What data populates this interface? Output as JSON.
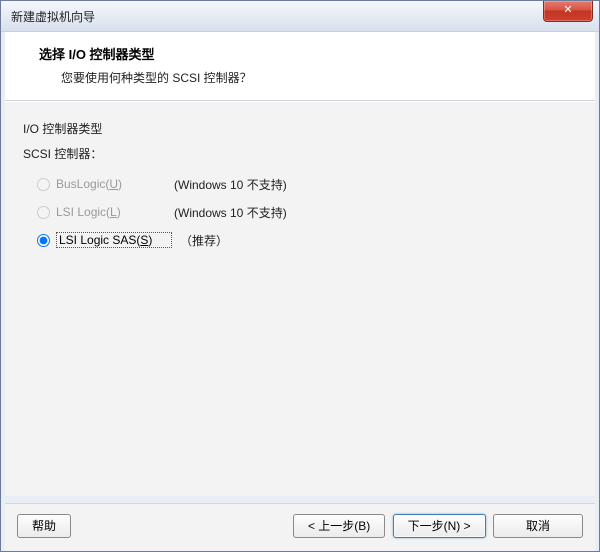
{
  "window": {
    "title": "新建虚拟机向导",
    "close_glyph": "✕"
  },
  "header": {
    "heading": "选择 I/O 控制器类型",
    "subtext": "您要使用何种类型的 SCSI 控制器？"
  },
  "content": {
    "section_label": "I/O 控制器类型",
    "group_label": "SCSI 控制器：",
    "options": [
      {
        "label": "BusLogic(U)",
        "accel": "U",
        "note": "(Windows 10 不支持)",
        "disabled": true,
        "selected": false
      },
      {
        "label": "LSI Logic(L)",
        "accel": "L",
        "note": "(Windows 10 不支持)",
        "disabled": true,
        "selected": false
      },
      {
        "label": "LSI Logic SAS(S)",
        "accel": "S",
        "note": "（推荐）",
        "disabled": false,
        "selected": true
      }
    ]
  },
  "footer": {
    "help": "帮助",
    "back": "< 上一步(B)",
    "next": "下一步(N) >",
    "cancel": "取消"
  }
}
